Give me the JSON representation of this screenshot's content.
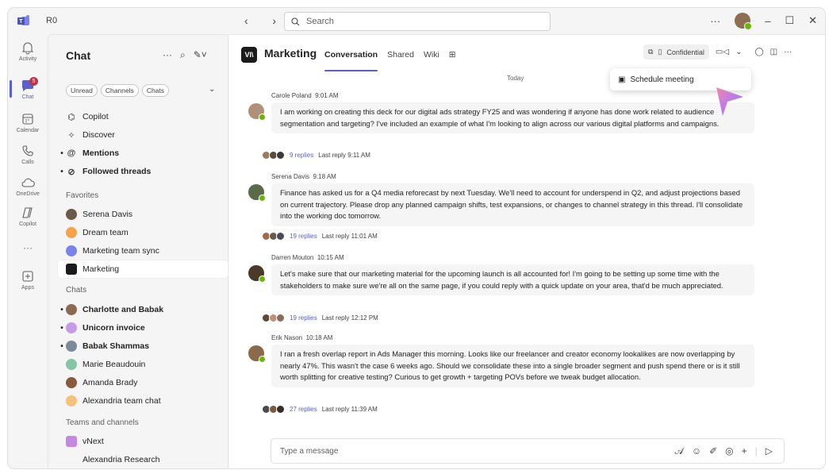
{
  "titlebar": {
    "initials": "R0",
    "search_placeholder": "Search",
    "more": "···"
  },
  "rail": [
    {
      "label": "Activity"
    },
    {
      "label": "Chat",
      "badge": "5"
    },
    {
      "label": "Calendar"
    },
    {
      "label": "Calls"
    },
    {
      "label": "OneDrive"
    },
    {
      "label": "Copilot"
    },
    {
      "label": "···"
    },
    {
      "label": "Apps"
    }
  ],
  "chatlist": {
    "title": "Chat",
    "filters": [
      "Unread",
      "Channels",
      "Chats"
    ],
    "top": [
      {
        "label": "Copilot"
      },
      {
        "label": "Discover"
      },
      {
        "label": "Mentions"
      },
      {
        "label": "Followed threads"
      }
    ],
    "favorites_title": "Favorites",
    "favorites": [
      "Serena Davis",
      "Dream team",
      "Marketing team sync",
      "Marketing"
    ],
    "chats_title": "Chats",
    "chats": [
      "Charlotte and Babak",
      "Unicorn invoice",
      "Babak Shammas",
      "Marie Beaudouin",
      "Amanda Brady",
      "Alexandria team chat"
    ],
    "teams_title": "Teams and channels",
    "teams": [
      "vNext",
      "Alexandria Research"
    ]
  },
  "channel": {
    "name": "Marketing",
    "logo": "VI\\",
    "tabs": [
      "Conversation",
      "Shared",
      "Wiki"
    ],
    "sensitivity": "Confidential",
    "menu_item": "Schedule meeting",
    "day_label": "Today"
  },
  "messages": [
    {
      "author": "Carole Poland",
      "time": "9:01 AM",
      "text": "I am working on creating this deck for our digital ads strategy FY25 and was wondering if anyone has done work related to audience segmentation and targeting? I've included an example of what I'm looking to align across our various digital platforms and campaigns.",
      "replies": "9 replies",
      "last": "Last reply 9:11 AM"
    },
    {
      "author": "Serena Davis",
      "time": "9:18 AM",
      "text": "Finance has asked us for a Q4 media reforecast by next Tuesday. We'll need to account for underspend in Q2, and adjust projections based on current trajectory. Please drop any planned campaign shifts, test expansions, or changes to channel strategy in this thread. I'll consolidate into the working doc tomorrow.",
      "replies": "19 replies",
      "last": "Last reply 11:01 AM"
    },
    {
      "author": "Darren Mouton",
      "time": "10:15 AM",
      "text": "Let's make sure that our marketing material for the upcoming launch is all accounted for! I'm going to be setting up some time with the stakeholders to make sure we're all on the same page, if you could reply with a quick update on your area, that'd be much appreciated.",
      "replies": "19 replies",
      "last": "Last reply 12:12 PM"
    },
    {
      "author": "Erik Nason",
      "time": "10:18 AM",
      "text": "I ran a fresh overlap report in Ads Manager this morning. Looks like our freelancer and creator economy lookalikes are now overlapping by nearly 47%. This wasn't the case 6 weeks ago. Should we consolidate these into a single broader segment and push spend there or is it still worth splitting for creative testing? Curious to get growth + targeting POVs before we tweak budget allocation.",
      "replies": "27 replies",
      "last": "Last reply 11:39 AM"
    }
  ],
  "compose": {
    "placeholder": "Type a message"
  },
  "colors": {
    "accent": "#5b5fc7",
    "presence": "#6bb700",
    "badge": "#c4314b"
  }
}
